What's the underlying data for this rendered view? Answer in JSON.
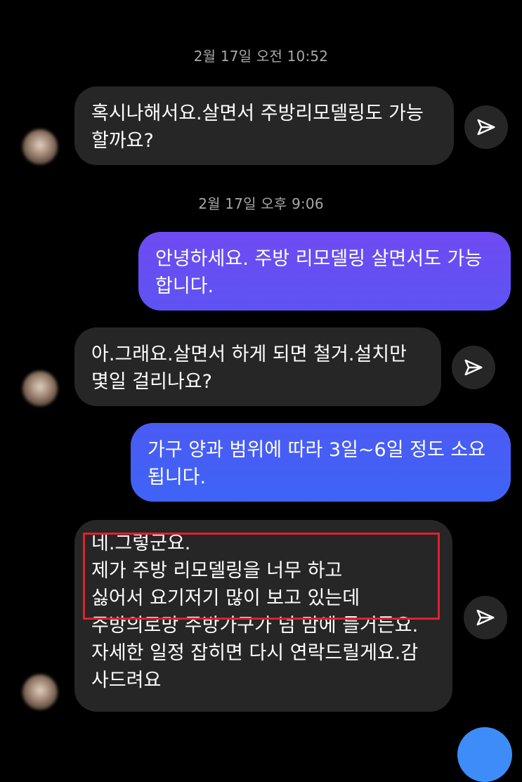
{
  "colors": {
    "background": "#000000",
    "incoming_bubble": "#262626",
    "outgoing_gradient_top": "#6f4bf2",
    "outgoing_gradient_bottom": "#4a5bf4",
    "outgoing_solid": "#3f63f6",
    "highlight_border": "#e0202f",
    "timestamp_text": "#a8a8a8"
  },
  "icons": {
    "share": "paper-plane-icon",
    "avatar": "user-avatar"
  },
  "conversation": {
    "timestamp_1": "2월 17일 오전 10:52",
    "timestamp_2": "2월 17일 오후 9:06",
    "messages": [
      {
        "direction": "incoming",
        "lines": [
          "혹시나해서요.살면서 주방리모델링도 가능",
          "할까요?"
        ]
      },
      {
        "direction": "outgoing",
        "lines": [
          "안녕하세요. 주방 리모델링 살면서도 가능",
          "합니다."
        ]
      },
      {
        "direction": "incoming",
        "lines": [
          "아.그래요.살면서 하게 되면 철거.설치만",
          "몇일 걸리나요?"
        ]
      },
      {
        "direction": "outgoing",
        "lines": [
          "가구 양과 범위에 따라 3일~6일 정도 소요",
          "됩니다."
        ]
      },
      {
        "direction": "incoming",
        "lines": [
          "네.그렇군요.",
          "제가 주방 리모델링을 너무 하고",
          "싫어서 요기저기 많이 보고 있는데",
          "주방의로망 주방가구가 넘 맘에 들거든요.",
          "자세한 일정 잡히면 다시 연락드릴게요.감",
          "사드려요"
        ]
      }
    ]
  }
}
